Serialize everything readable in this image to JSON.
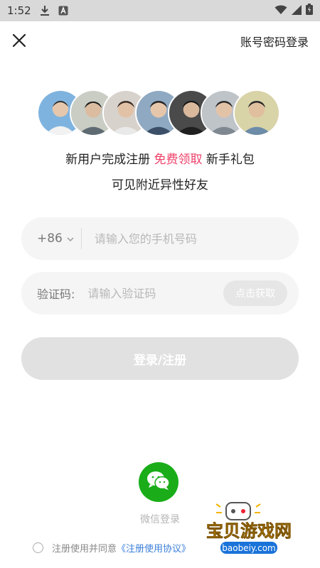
{
  "status_bar": {
    "time": "1:52"
  },
  "header": {
    "account_login": "账号密码登录"
  },
  "promo": {
    "line1_prefix": "新用户完成注册",
    "line1_highlight": "免费领取",
    "line1_suffix": "新手礼包",
    "line2": "可见附近异性好友",
    "highlight_color": "#f0406a"
  },
  "phone_field": {
    "country_code": "+86",
    "placeholder": "请输入您的手机号码"
  },
  "code_field": {
    "label": "验证码:",
    "placeholder": "请输入验证码",
    "get_code": "点击获取"
  },
  "login_button": "登录/注册",
  "wechat_login": "微信登录",
  "agreement": {
    "prefix": "注册使用并同意",
    "link": "《注册使用协议》"
  },
  "watermark": {
    "name": "宝贝游戏网",
    "url": "baobeiy.com"
  }
}
